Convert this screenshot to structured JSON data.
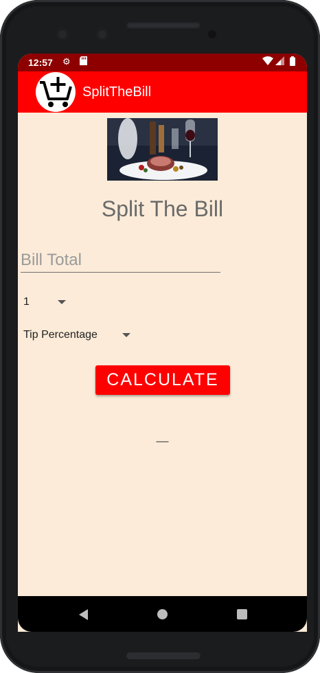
{
  "status": {
    "time": "12:57",
    "icons": [
      "gear-icon",
      "sd-card-icon",
      "wifi-icon",
      "signal-icon",
      "battery-icon"
    ]
  },
  "toolbar": {
    "title": "SplitTheBill",
    "logo_icon": "cart-plus-icon",
    "color": "#ff0000"
  },
  "main": {
    "heading": "Split The Bill",
    "bill_input": {
      "placeholder": "Bill Total",
      "value": ""
    },
    "people_spinner": {
      "selected": "1"
    },
    "tip_spinner": {
      "selected": "Tip Percentage"
    },
    "calculate_label": "CALCULATE",
    "result": "—",
    "background": "#fbebd8"
  },
  "nav": {
    "icons": [
      "back-icon",
      "home-icon",
      "recents-icon"
    ]
  }
}
